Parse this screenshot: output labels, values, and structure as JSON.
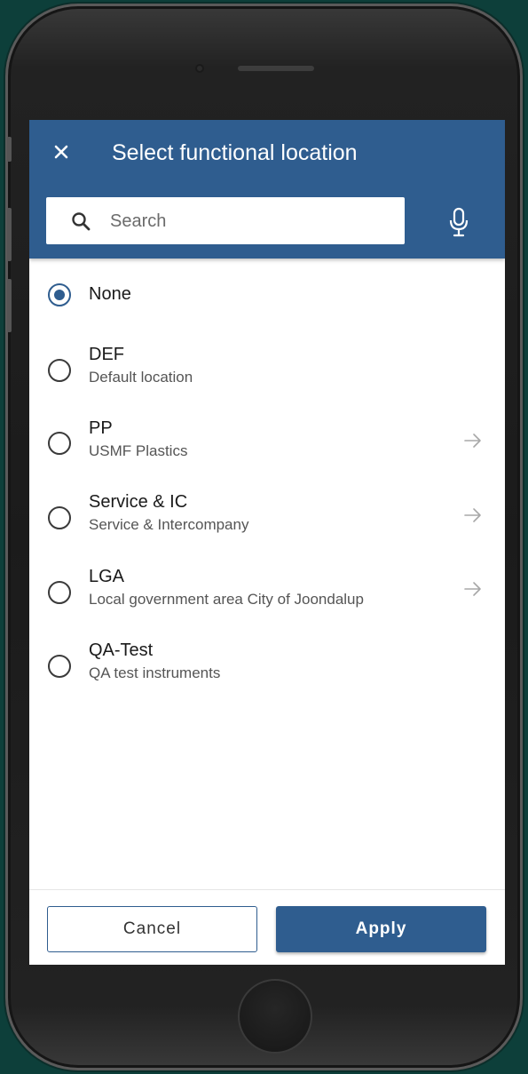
{
  "header": {
    "close_icon": "close-icon",
    "title": "Select functional location",
    "search_placeholder": "Search",
    "search_value": "",
    "mic_icon": "microphone-icon",
    "color": "#2f5d8f"
  },
  "items": [
    {
      "title": "None",
      "subtitle": "",
      "selected": true,
      "has_children": false
    },
    {
      "title": "DEF",
      "subtitle": "Default location",
      "selected": false,
      "has_children": false
    },
    {
      "title": "PP",
      "subtitle": "USMF Plastics",
      "selected": false,
      "has_children": true
    },
    {
      "title": "Service & IC",
      "subtitle": "Service & Intercompany",
      "selected": false,
      "has_children": true
    },
    {
      "title": "LGA",
      "subtitle": "Local government area City of Joondalup",
      "selected": false,
      "has_children": true
    },
    {
      "title": "QA-Test",
      "subtitle": "QA test instruments",
      "selected": false,
      "has_children": false
    }
  ],
  "footer": {
    "cancel_label": "Cancel",
    "apply_label": "Apply"
  }
}
